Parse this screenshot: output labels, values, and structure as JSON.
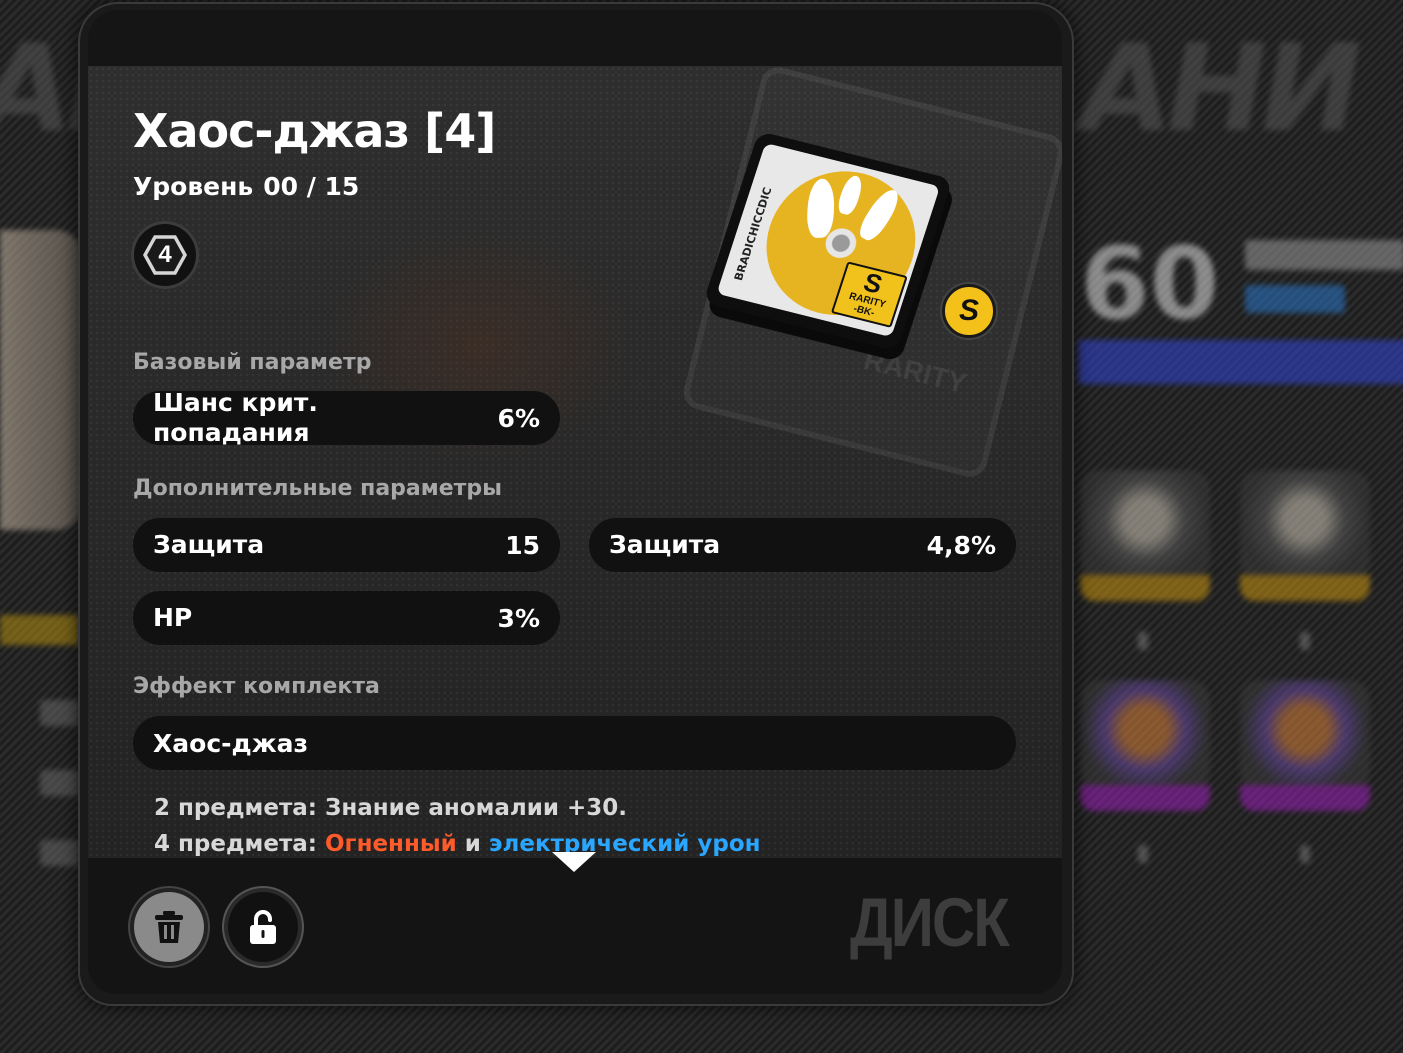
{
  "item": {
    "title": "Хаос-джаз [4]",
    "level_label": "Уровень",
    "level_value": "00 / 15",
    "set_slot": "4",
    "rank": "S",
    "disc_brand": "BRADICHICCDIC",
    "rarity_letter": "S",
    "rarity_word": "RARITY",
    "rarity_sub": "-BK-"
  },
  "base": {
    "label": "Базовый параметр",
    "stats": [
      {
        "name": "Шанс крит. попадания",
        "value": "6%"
      }
    ]
  },
  "sub": {
    "label": "Дополнительные параметры",
    "stats": [
      {
        "name": "Защита",
        "value": "15"
      },
      {
        "name": "Защита",
        "value": "4,8%"
      },
      {
        "name": "HP",
        "value": "3%"
      }
    ]
  },
  "set_effect": {
    "label": "Эффект комплекта",
    "name": "Хаос-джаз",
    "line1": "2 предмета: Знание аномалии +30.",
    "line2_prefix": "4 предмета: ",
    "line2_fire": "Огненный",
    "line2_mid": " и ",
    "line2_elec": "электрический урон"
  },
  "footer": {
    "category": "ДИСК"
  },
  "background": {
    "level": "60"
  },
  "colors": {
    "rank_gold": "#f3c11a",
    "fire": "#ff5a2a",
    "electric": "#2aa6ff",
    "bar_blue": "#3245d8"
  },
  "icons": [
    "trash-icon",
    "unlock-icon",
    "chevron-down-icon"
  ]
}
